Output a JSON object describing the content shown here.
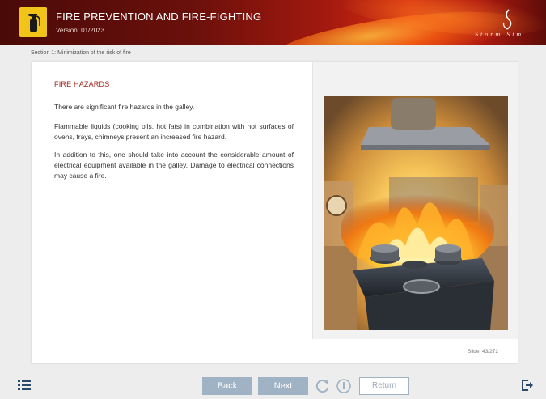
{
  "header": {
    "title": "FIRE PREVENTION AND FIRE-FIGHTING",
    "version": "Version: 01/2023",
    "logo_icon": "fire-extinguisher-icon",
    "brand_text": "Storm Sim",
    "accent_color": "#a3261c",
    "badge_color": "#f0c419"
  },
  "breadcrumb": {
    "section": "Section 1: Minimization of the risk of fire"
  },
  "content": {
    "heading": "FIRE HAZARDS",
    "paragraphs": [
      "There are significant fire hazards in the galley.",
      "Flammable liquids (cooking oils, hot fats) in combination with hot surfaces of ovens, trays, chimneys present an increased fire hazard.",
      "In addition to this, one should take into account the considerable amount of electrical equipment available in the galley. Damage to electrical connections may cause a fire."
    ],
    "image": "galley-fire-illustration"
  },
  "slide_counter": "Slide: 43/272",
  "footer": {
    "menu_icon": "list-menu-icon",
    "back_label": "Back",
    "next_label": "Next",
    "reload_icon": "reload-icon",
    "info_icon": "info-icon",
    "return_label": "Return",
    "exit_icon": "exit-icon",
    "button_color": "#a0b3c4"
  }
}
